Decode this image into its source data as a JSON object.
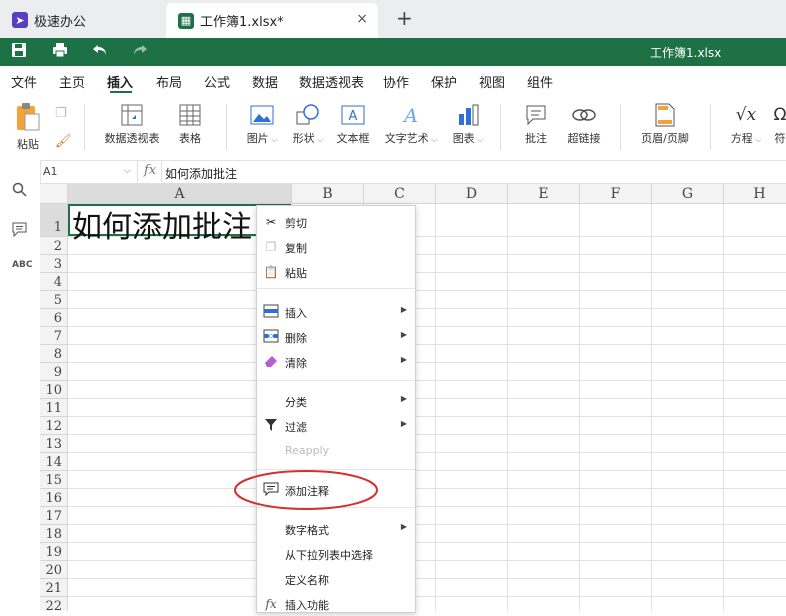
{
  "tabs": [
    {
      "label": "极速办公",
      "icon": "rocket-icon",
      "color": "#5b3cc4"
    },
    {
      "label": "工作簿1.xlsx*",
      "icon": "spreadsheet-icon",
      "color": "#1e7145"
    }
  ],
  "tab_add": "+",
  "tab_close": "×",
  "title_bar": {
    "doc_title": "工作簿1.xlsx",
    "color": "#1e7145"
  },
  "menus": [
    "文件",
    "主页",
    "插入",
    "布局",
    "公式",
    "数据",
    "数据透视表",
    "协作",
    "保护",
    "视图",
    "组件"
  ],
  "active_menu": "插入",
  "ribbon": {
    "paste": "粘贴",
    "pivot": "数据透视表",
    "table": "表格",
    "picture": "图片",
    "shape": "形状",
    "textbox": "文本框",
    "wordart": "文字艺术",
    "chart": "图表",
    "comment": "批注",
    "hyperlink": "超链接",
    "header_footer": "页眉/页脚",
    "equation": "方程",
    "symbol": "符"
  },
  "formula": {
    "cell": "A1",
    "fx": "fx",
    "value": "如何添加批注"
  },
  "columns": [
    "A",
    "B",
    "C",
    "D",
    "E",
    "F",
    "G",
    "H"
  ],
  "rows": [
    "1",
    "2",
    "3",
    "4",
    "5",
    "6",
    "7",
    "8",
    "9",
    "10",
    "11",
    "12",
    "13",
    "14",
    "15",
    "16",
    "17",
    "18",
    "19",
    "20",
    "21",
    "22"
  ],
  "cell_a1": "如何添加批注",
  "context_menu": {
    "cut": "剪切",
    "copy": "复制",
    "paste": "粘贴",
    "insert": "插入",
    "delete": "删除",
    "clear": "清除",
    "sort": "分类",
    "filter": "过滤",
    "reapply": "Reapply",
    "add_note": "添加注释",
    "number_format": "数字格式",
    "pick_list": "从下拉列表中选择",
    "define_name": "定义名称",
    "insert_function": "插入功能"
  },
  "highlight_color": "#d62f2f"
}
